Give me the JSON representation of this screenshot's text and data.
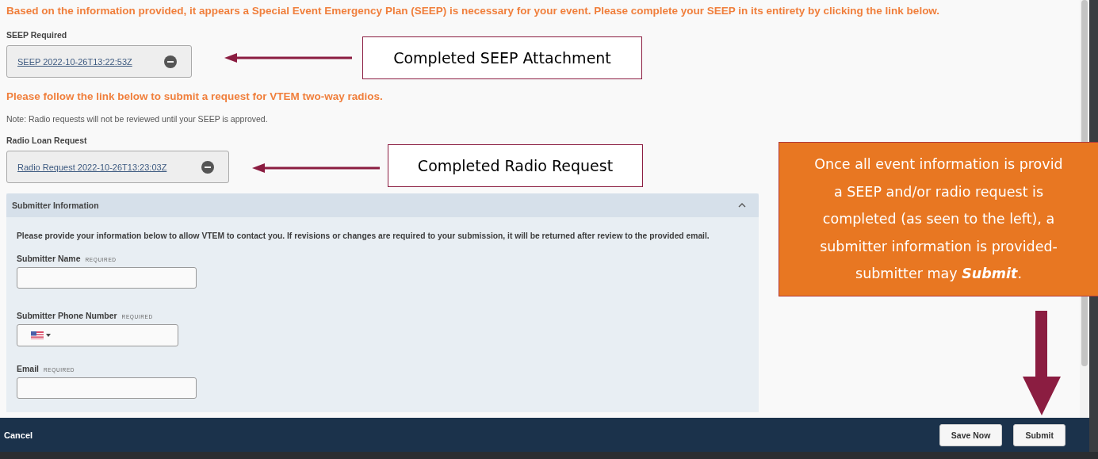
{
  "notice": "Based on the information provided, it appears a Special Event Emergency Plan (SEEP) is necessary for your event. Please complete your SEEP in its entirety by clicking the link below.",
  "seep": {
    "label": "SEEP Required",
    "attachment": "SEEP 2022-10-26T13:22:53Z"
  },
  "radio_notice": "Please follow the link below to submit a request for VTEM two-way radios.",
  "note": "Note: Radio requests will not be reviewed until your SEEP is approved.",
  "radio": {
    "label": "Radio Loan Request",
    "attachment": "Radio Request 2022-10-26T13:23:03Z"
  },
  "submitter_section": {
    "title": "Submitter Information",
    "expanded": true,
    "description": "Please provide your information below to allow VTEM to contact you. If revisions or changes are required to your submission, it will be returned after review to the provided email.",
    "fields": [
      {
        "label": "Submitter Name",
        "badge": "REQUIRED",
        "kind": "text"
      },
      {
        "label": "Submitter Phone Number",
        "badge": "REQUIRED",
        "kind": "phone"
      },
      {
        "label": "Email",
        "badge": "REQUIRED",
        "kind": "text"
      }
    ]
  },
  "footer": {
    "cancel": "Cancel",
    "buttons": [
      "Save Now",
      "Submit"
    ]
  },
  "annotations": [
    {
      "text": "Completed SEEP Attachment"
    },
    {
      "text": "Completed Radio Request"
    }
  ],
  "callout": {
    "lines": [
      "Once all event information is provid",
      "a SEEP and/or radio request is",
      "completed (as seen to the left), a",
      "submitter information is provided-",
      "submitter may **Submit**."
    ]
  }
}
